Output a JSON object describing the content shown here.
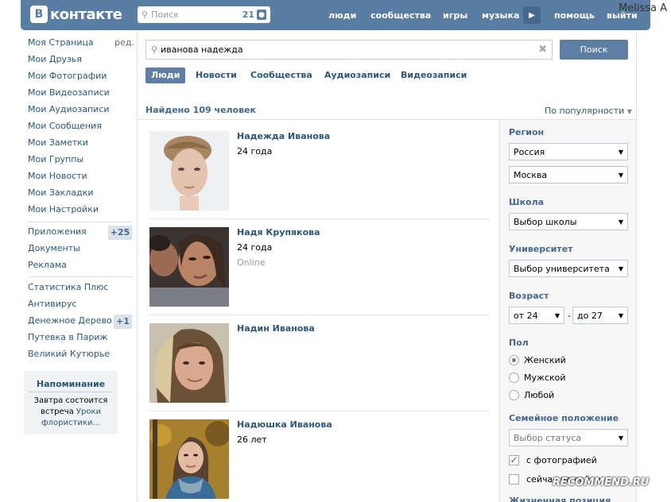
{
  "header": {
    "logo_letter": "В",
    "logo_text": "контакте",
    "search_placeholder": "Поиск",
    "search_count": "21",
    "nav": [
      "люди",
      "сообщества",
      "игры",
      "музыка",
      "помощь",
      "выйти"
    ],
    "user_name": "Melissa A"
  },
  "sidebar": {
    "edit_label": "ред.",
    "items": [
      {
        "label": "Моя Страница"
      },
      {
        "label": "Мои Друзья"
      },
      {
        "label": "Мои Фотографии"
      },
      {
        "label": "Мои Видеозаписи"
      },
      {
        "label": "Мои Аудиозаписи"
      },
      {
        "label": "Мои Сообщения"
      },
      {
        "label": "Мои Заметки"
      },
      {
        "label": "Мои Группы"
      },
      {
        "label": "Мои Новости"
      },
      {
        "label": "Мои Закладки"
      },
      {
        "label": "Мои Настройки"
      }
    ],
    "apps": [
      {
        "label": "Приложения",
        "badge": "+25"
      },
      {
        "label": "Документы",
        "badge": ""
      },
      {
        "label": "Реклама",
        "badge": ""
      }
    ],
    "games": [
      {
        "label": "Статистика Плюс",
        "badge": ""
      },
      {
        "label": "Антивирус",
        "badge": ""
      },
      {
        "label": "Денежное Дерево",
        "badge": "+1"
      },
      {
        "label": "Путевка в Париж",
        "badge": ""
      },
      {
        "label": "Великий Кутюрье",
        "badge": ""
      }
    ],
    "reminder": {
      "title": "Напоминание",
      "line1_a": "Завтра ",
      "line1_b": "состоится",
      "line2_a": "встреча ",
      "line2_b": "Уроки",
      "line3": "флористики..."
    }
  },
  "search": {
    "query": "иванова надежда",
    "button": "Поиск",
    "tabs": [
      "Люди",
      "Новости",
      "Сообщества",
      "Аудиозаписи",
      "Видеозаписи"
    ],
    "active_tab": "Люди",
    "found": "Найдено 109 человек",
    "sort": "По популярности"
  },
  "results": [
    {
      "name": "Надежда Иванова",
      "age": "24 года",
      "online": ""
    },
    {
      "name": "Надя Крупякова",
      "age": "24 года",
      "online": "Online"
    },
    {
      "name": "Надин Иванова",
      "age": "",
      "online": ""
    },
    {
      "name": "Надюшка Иванова",
      "age": "26 лет",
      "online": ""
    }
  ],
  "filters": {
    "region_label": "Регион",
    "country": "Россия",
    "city": "Москва",
    "school_label": "Школа",
    "school": "Выбор школы",
    "university_label": "Университет",
    "university": "Выбор университета",
    "age_label": "Возраст",
    "age_from": "от 24",
    "age_dash": "-",
    "age_to": "до 27",
    "gender_label": "Пол",
    "gender_options": [
      "Женский",
      "Мужской",
      "Любой"
    ],
    "gender_selected": "Женский",
    "marital_label": "Семейное положение",
    "marital": "Выбор статуса",
    "with_photo": "с фотографией",
    "online_now": "сейчас на сайте",
    "more_label": "Жизненная позиция"
  },
  "watermark": "RECOMMEND.RU"
}
